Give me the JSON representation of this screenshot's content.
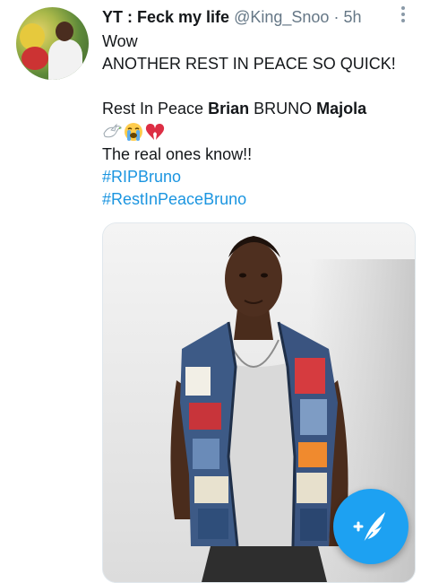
{
  "tweet": {
    "display_name": "YT : Feck my life",
    "handle": "@King_Snoo",
    "separator": "·",
    "time": "5h",
    "lines": {
      "l1": "Wow",
      "l2": "ANOTHER REST IN PEACE SO QUICK!",
      "rip_prefix": "Rest In Peace ",
      "rip_name1": "Brian",
      "rip_mid": " BRUNO ",
      "rip_name2": "Majola",
      "l5": "The real ones know!!"
    },
    "emojis": [
      "dove-icon",
      "loudly-crying-face-icon",
      "broken-heart-icon"
    ],
    "hashtags": [
      "#RIPBruno",
      "#RestInPeaceBruno"
    ]
  },
  "colors": {
    "link": "#1b95e0",
    "fab": "#1da1f2",
    "secondary_text": "#657786"
  },
  "fab": {
    "icon": "compose-tweet-icon"
  }
}
